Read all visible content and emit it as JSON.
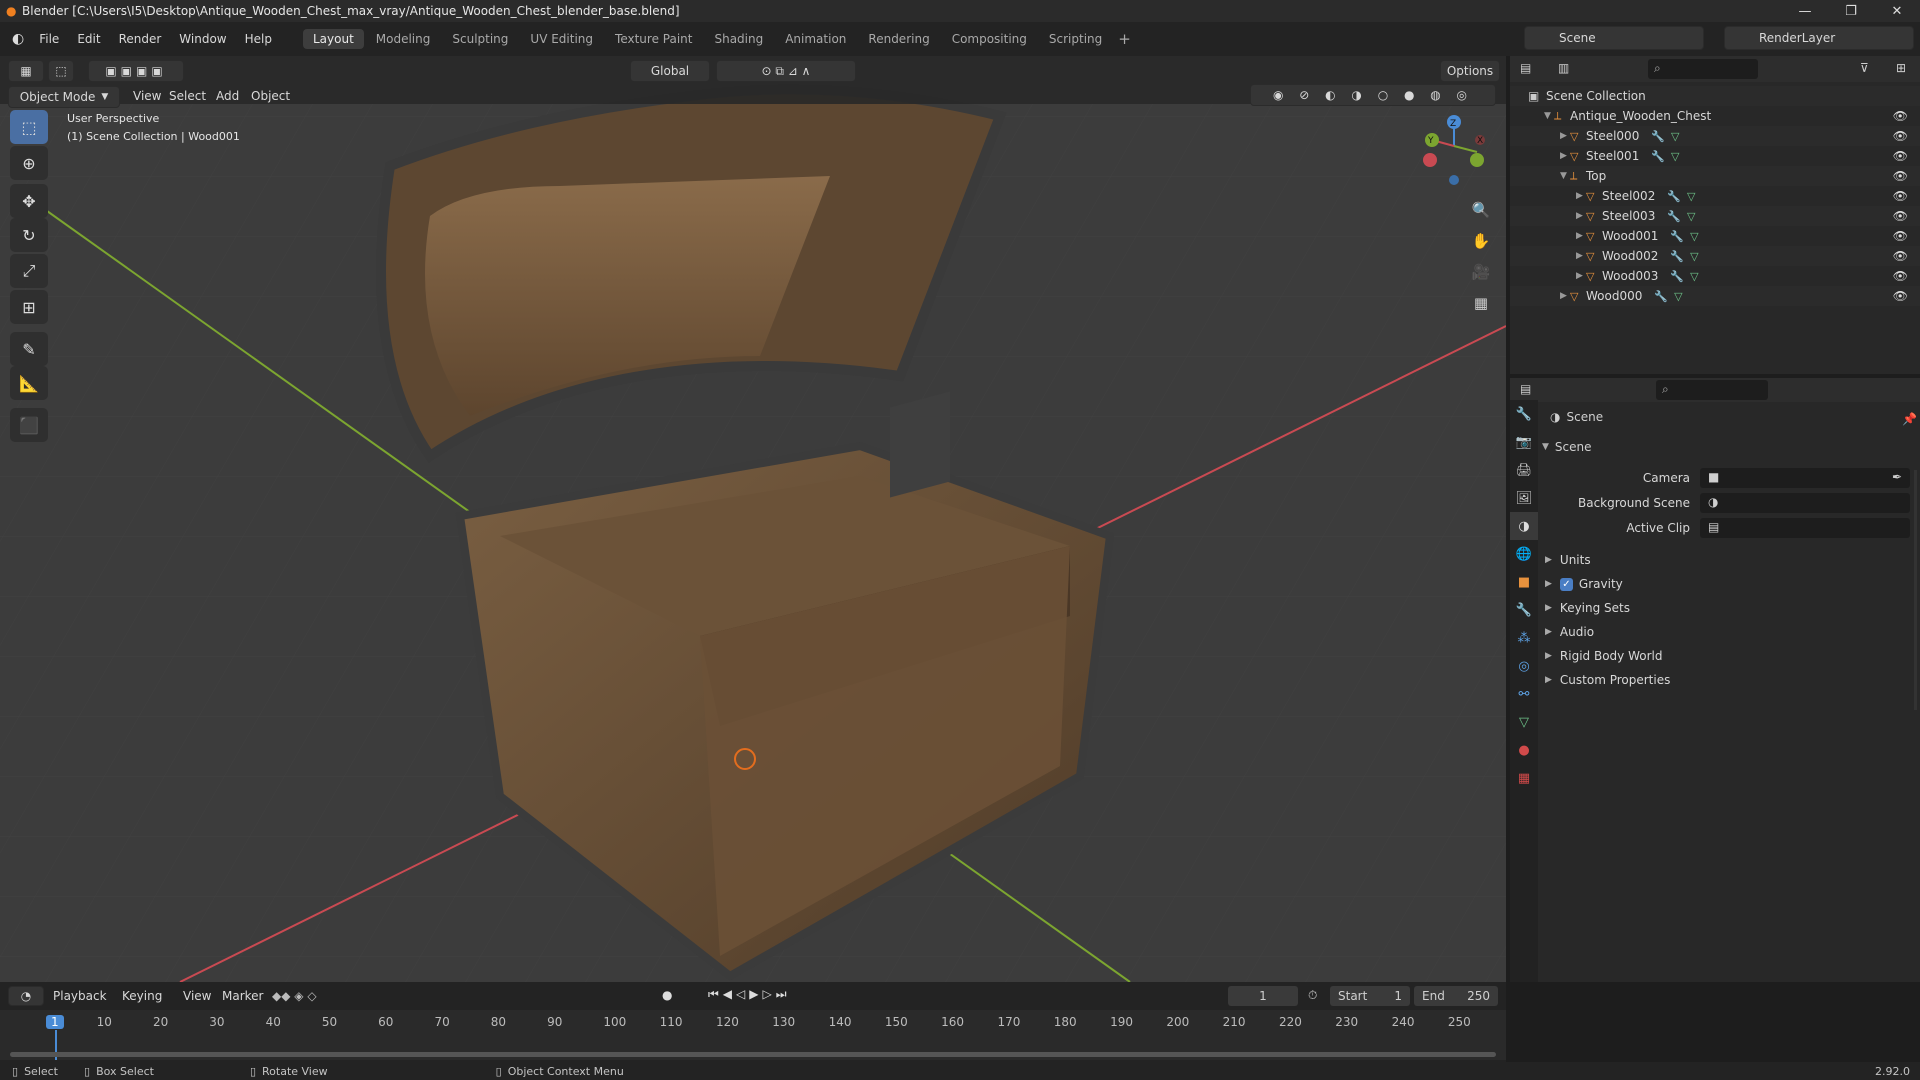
{
  "window": {
    "title": "Blender [C:\\Users\\I5\\Desktop\\Antique_Wooden_Chest_max_vray/Antique_Wooden_Chest_blender_base.blend]"
  },
  "menu": {
    "items": [
      "File",
      "Edit",
      "Render",
      "Window",
      "Help"
    ]
  },
  "workspaces": [
    "Layout",
    "Modeling",
    "Sculpting",
    "UV Editing",
    "Texture Paint",
    "Shading",
    "Animation",
    "Rendering",
    "Compositing",
    "Scripting"
  ],
  "active_workspace": "Layout",
  "scene_selector": {
    "value": "Scene"
  },
  "renderlayer_selector": {
    "value": "RenderLayer"
  },
  "viewport": {
    "mode": "Object Mode",
    "menus": [
      "View",
      "Select",
      "Add",
      "Object"
    ],
    "transform_orientation": "Global",
    "options_label": "Options",
    "overlay_line1": "User Perspective",
    "overlay_line2": "(1) Scene Collection | Wood001",
    "gizmo": {
      "x": "X",
      "y": "Y",
      "z": "Z"
    }
  },
  "outliner": {
    "root": "Scene Collection",
    "rows": [
      {
        "label": "Antique_Wooden_Chest",
        "indent": 1,
        "kind": "empty"
      },
      {
        "label": "Steel000",
        "indent": 2,
        "kind": "mesh"
      },
      {
        "label": "Steel001",
        "indent": 2,
        "kind": "mesh"
      },
      {
        "label": "Top",
        "indent": 2,
        "kind": "empty"
      },
      {
        "label": "Steel002",
        "indent": 3,
        "kind": "mesh"
      },
      {
        "label": "Steel003",
        "indent": 3,
        "kind": "mesh"
      },
      {
        "label": "Wood001",
        "indent": 3,
        "kind": "mesh"
      },
      {
        "label": "Wood002",
        "indent": 3,
        "kind": "mesh"
      },
      {
        "label": "Wood003",
        "indent": 3,
        "kind": "mesh"
      },
      {
        "label": "Wood000",
        "indent": 2,
        "kind": "mesh"
      }
    ]
  },
  "properties": {
    "context": "Scene",
    "panel": "Scene",
    "fields": [
      {
        "label": "Camera"
      },
      {
        "label": "Background Scene"
      },
      {
        "label": "Active Clip"
      }
    ],
    "sections": [
      "Units",
      "Gravity",
      "Keying Sets",
      "Audio",
      "Rigid Body World",
      "Custom Properties"
    ],
    "gravity_checked": true
  },
  "timeline": {
    "menus": [
      "Playback",
      "Keying",
      "View",
      "Marker"
    ],
    "current_frame": "1",
    "start_label": "Start",
    "start": "1",
    "end_label": "End",
    "end": "250",
    "ticks": [
      "1",
      "10",
      "20",
      "30",
      "40",
      "50",
      "60",
      "70",
      "80",
      "90",
      "100",
      "110",
      "120",
      "130",
      "140",
      "150",
      "160",
      "170",
      "180",
      "190",
      "200",
      "210",
      "220",
      "230",
      "240",
      "250"
    ]
  },
  "statusbar": {
    "select": "Select",
    "box_select": "Box Select",
    "rotate_view": "Rotate View",
    "context_menu": "Object Context Menu",
    "version": "2.92.0"
  },
  "colors": {
    "accent": "#4a6fa3",
    "frame_marker": "#4a8cd6",
    "x_axis": "#c94a52",
    "y_axis": "#7ca530",
    "object": "#e8923d"
  }
}
